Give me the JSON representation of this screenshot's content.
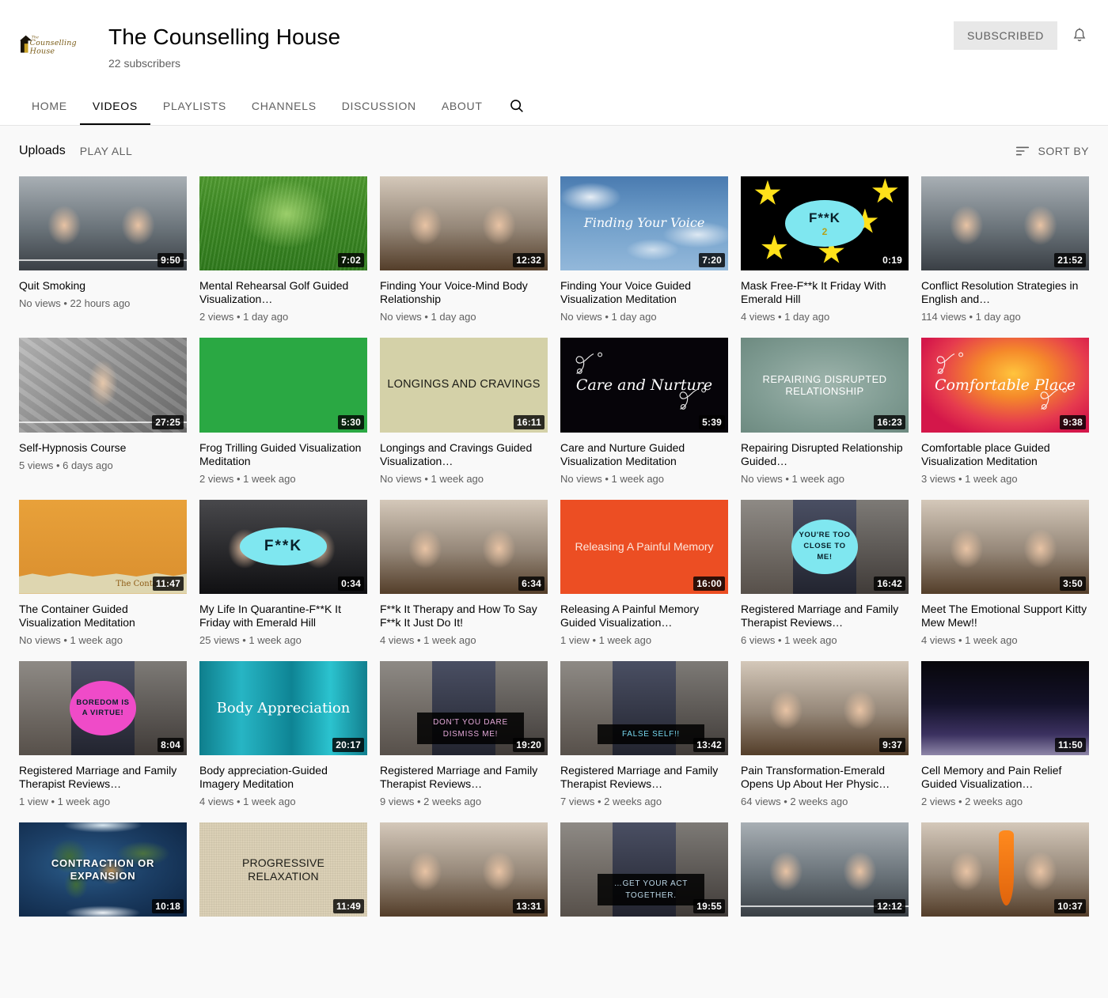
{
  "channel": {
    "name": "The Counselling House",
    "subscribers": "22 subscribers",
    "avatar_wordmark_top": "The",
    "avatar_wordmark_main": "Counselling House",
    "subscribe_button": "SUBSCRIBED",
    "bell_icon": "notification-bell-icon"
  },
  "tabs": [
    {
      "label": "HOME",
      "active": false
    },
    {
      "label": "VIDEOS",
      "active": true
    },
    {
      "label": "PLAYLISTS",
      "active": false
    },
    {
      "label": "CHANNELS",
      "active": false
    },
    {
      "label": "DISCUSSION",
      "active": false
    },
    {
      "label": "ABOUT",
      "active": false
    }
  ],
  "search_icon": "search-icon",
  "section": {
    "title": "Uploads",
    "play_all": "PLAY ALL",
    "sort_by": "SORT BY",
    "sort_icon": "sort-lines-icon"
  },
  "videos": [
    {
      "title": "Quit Smoking",
      "meta": "No views • 22 hours ago",
      "duration": "9:50",
      "thumb_kind": "photo-studio",
      "thumb_text": "",
      "progress": true
    },
    {
      "title": "Mental Rehearsal Golf Guided Visualization…",
      "meta": "2 views • 1 day ago",
      "duration": "7:02",
      "thumb_kind": "grass",
      "thumb_text": ""
    },
    {
      "title": "Finding Your Voice-Mind Body Relationship",
      "meta": "No views • 1 day ago",
      "duration": "12:32",
      "thumb_kind": "photo-office",
      "thumb_text": ""
    },
    {
      "title": "Finding Your Voice Guided Visualization Meditation",
      "meta": "No views • 1 day ago",
      "duration": "7:20",
      "thumb_kind": "sky",
      "thumb_text": "Finding Your Voice"
    },
    {
      "title": "Mask Free-F**k It Friday With Emerald Hill",
      "meta": "4 views • 1 day ago",
      "duration": "0:19",
      "thumb_kind": "stars",
      "thumb_text": "F**K",
      "thumb_text2": "2"
    },
    {
      "title": "Conflict Resolution Strategies in English and…",
      "meta": "114 views • 1 day ago",
      "duration": "21:52",
      "thumb_kind": "photo-studio",
      "thumb_text": ""
    },
    {
      "title": "Self-Hypnosis Course",
      "meta": "5 views • 6 days ago",
      "duration": "27:25",
      "thumb_kind": "photo-silver",
      "thumb_text": "",
      "progress": true
    },
    {
      "title": "Frog Trilling Guided Visualization Meditation",
      "meta": "2 views • 1 week ago",
      "duration": "5:30",
      "thumb_kind": "green-flat",
      "thumb_text": ""
    },
    {
      "title": "Longings and Cravings Guided Visualization…",
      "meta": "No views • 1 week ago",
      "duration": "16:11",
      "thumb_kind": "beige",
      "thumb_text": "LONGINGS AND CRAVINGS"
    },
    {
      "title": "Care and Nurture Guided Visualization Meditation",
      "meta": "No views • 1 week ago",
      "duration": "5:39",
      "thumb_kind": "black-script",
      "thumb_text": "Care and Nurture"
    },
    {
      "title": "Repairing Disrupted Relationship Guided…",
      "meta": "No views • 1 week ago",
      "duration": "16:23",
      "thumb_kind": "teal-grad",
      "thumb_text": "REPAIRING DISRUPTED RELATIONSHIP"
    },
    {
      "title": "Comfortable place Guided Visualization Meditation",
      "meta": "3 views • 1 week ago",
      "duration": "9:38",
      "thumb_kind": "sunset",
      "thumb_text": "Comfortable Place"
    },
    {
      "title": "The Container Guided Visualization Meditation",
      "meta": "No views • 1 week ago",
      "duration": "11:47",
      "thumb_kind": "orange-paper",
      "thumb_text": "The Container"
    },
    {
      "title": "My Life In Quarantine-F**K It Friday with Emerald Hill",
      "meta": "25 views • 1 week ago",
      "duration": "0:34",
      "thumb_kind": "dark-oval",
      "thumb_text": "F**K"
    },
    {
      "title": "F**k It Therapy and How To Say F**k It Just Do It!",
      "meta": "4 views • 1 week ago",
      "duration": "6:34",
      "thumb_kind": "photo-office",
      "thumb_text": ""
    },
    {
      "title": "Releasing A Painful Memory Guided Visualization…",
      "meta": "1 view • 1 week ago",
      "duration": "16:00",
      "thumb_kind": "red-flat",
      "thumb_text": "Releasing A Painful Memory"
    },
    {
      "title": "Registered Marriage and Family Therapist Reviews…",
      "meta": "6 views • 1 week ago",
      "duration": "16:42",
      "thumb_kind": "collage-cyan",
      "thumb_text": "YOU'RE TOO CLOSE TO ME!"
    },
    {
      "title": "Meet The Emotional Support Kitty Mew Mew!!",
      "meta": "4 views • 1 week ago",
      "duration": "3:50",
      "thumb_kind": "photo-office",
      "thumb_text": ""
    },
    {
      "title": "Registered Marriage and Family Therapist Reviews…",
      "meta": "1 view • 1 week ago",
      "duration": "8:04",
      "thumb_kind": "collage-pink",
      "thumb_text": "BOREDOM IS A VIRTUE!"
    },
    {
      "title": "Body appreciation-Guided Imagery Meditation",
      "meta": "4 views • 1 week ago",
      "duration": "20:17",
      "thumb_kind": "turquoise",
      "thumb_text": "Body Appreciation"
    },
    {
      "title": "Registered Marriage and Family Therapist Reviews…",
      "meta": "9 views • 2 weeks ago",
      "duration": "19:20",
      "thumb_kind": "collage-dark",
      "thumb_text": "DON'T YOU DARE DISMISS ME!"
    },
    {
      "title": "Registered Marriage and Family Therapist Reviews…",
      "meta": "7 views • 2 weeks ago",
      "duration": "13:42",
      "thumb_kind": "collage-false",
      "thumb_text": "FALSE SELF!!"
    },
    {
      "title": "Pain Transformation-Emerald Opens Up About Her Physic…",
      "meta": "64 views • 2 weeks ago",
      "duration": "9:37",
      "thumb_kind": "photo-office",
      "thumb_text": ""
    },
    {
      "title": "Cell Memory and Pain Relief Guided Visualization…",
      "meta": "2 views • 2 weeks ago",
      "duration": "11:50",
      "thumb_kind": "purple-grad",
      "thumb_text": ""
    },
    {
      "title": "",
      "meta": "",
      "duration": "10:18",
      "thumb_kind": "earth",
      "thumb_text": "CONTRACTION OR EXPANSION"
    },
    {
      "title": "",
      "meta": "",
      "duration": "11:49",
      "thumb_kind": "linen",
      "thumb_text": "PROGRESSIVE RELAXATION"
    },
    {
      "title": "",
      "meta": "",
      "duration": "13:31",
      "thumb_kind": "photo-office",
      "thumb_text": ""
    },
    {
      "title": "",
      "meta": "",
      "duration": "19:55",
      "thumb_kind": "collage-act",
      "thumb_text": "…GET YOUR ACT TOGETHER."
    },
    {
      "title": "",
      "meta": "",
      "duration": "12:12",
      "thumb_kind": "photo-studio",
      "thumb_text": "",
      "progress": true
    },
    {
      "title": "",
      "meta": "",
      "duration": "10:37",
      "thumb_kind": "photo-carrot",
      "thumb_text": ""
    }
  ]
}
